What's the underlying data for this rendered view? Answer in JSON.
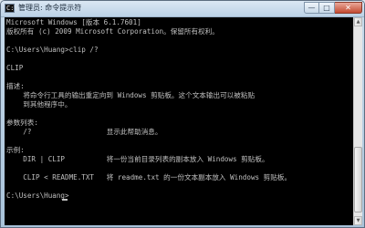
{
  "window": {
    "title": "管理员: 命令提示符",
    "controls": {
      "minimize": "—",
      "maximize": "□",
      "close": "✕"
    },
    "icon_prompt": "C:\\"
  },
  "console": {
    "lines": [
      "Microsoft Windows [版本 6.1.7601]",
      "版权所有 (c) 2009 Microsoft Corporation。保留所有权利。",
      "",
      "C:\\Users\\Huang>clip /?",
      "",
      "CLIP",
      "",
      "描述:",
      "    将命令行工具的输出重定向到 Windows 剪贴板。这个文本输出可以被粘贴",
      "    到其他程序中。",
      "",
      "参数列表:",
      "    /?                  显示此帮助消息。",
      "",
      "示例:",
      "    DIR | CLIP          将一份当前目录列表的副本放入 Windows 剪贴板。",
      "",
      "    CLIP < README.TXT   将 readme.txt 的一份文本副本放入 Windows 剪贴板。",
      "",
      "C:\\Users\\Huang>"
    ]
  },
  "colors": {
    "console_background": "#000000",
    "console_text": "#c0c0c0",
    "close_button": "#c44a31"
  }
}
